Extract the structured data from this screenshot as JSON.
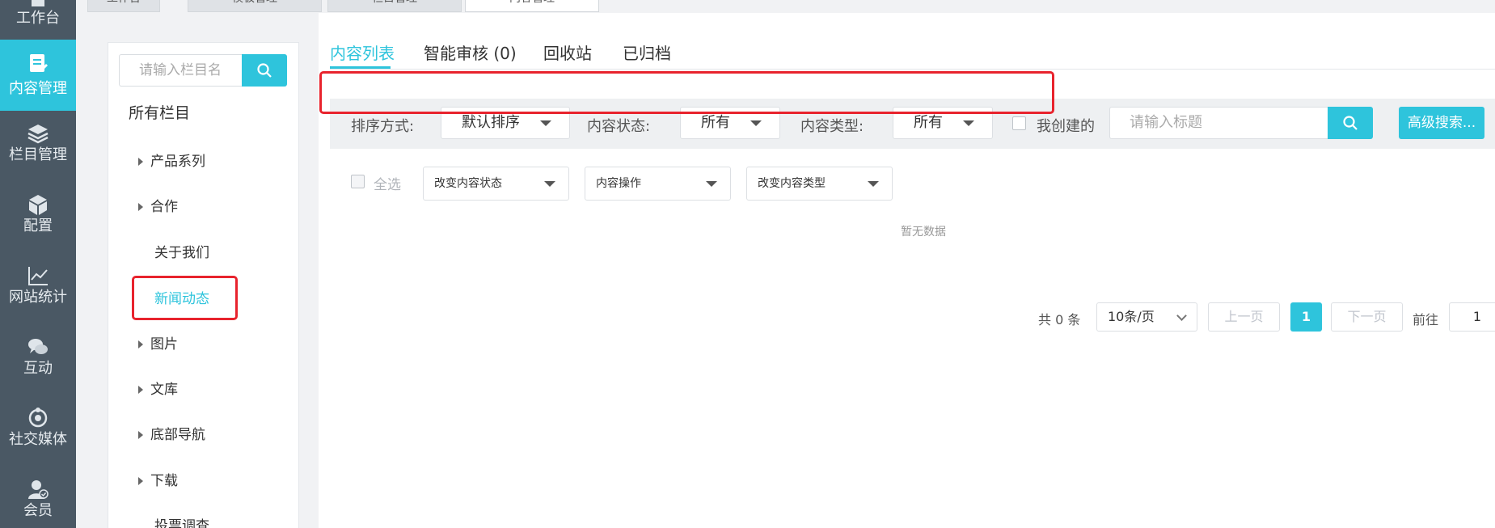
{
  "sidebar": {
    "items": [
      {
        "label": "工作台",
        "icon": "workbench-icon"
      },
      {
        "label": "内容管理",
        "icon": "content-icon",
        "active": true
      },
      {
        "label": "栏目管理",
        "icon": "layers-icon"
      },
      {
        "label": "配置",
        "icon": "box-icon"
      },
      {
        "label": "网站统计",
        "icon": "chart-line-icon"
      },
      {
        "label": "互动",
        "icon": "chat-icon"
      },
      {
        "label": "社交媒体",
        "icon": "social-icon"
      },
      {
        "label": "会员",
        "icon": "member-icon"
      }
    ]
  },
  "top_tabs": [
    "工作台",
    "模板管理",
    "栏目管理",
    "内容管理"
  ],
  "tree": {
    "search_placeholder": "请输入栏目名",
    "root": "所有栏目",
    "nodes": [
      {
        "label": "产品系列",
        "has_children": true
      },
      {
        "label": "合作",
        "has_children": true
      },
      {
        "label": "关于我们",
        "has_children": false
      },
      {
        "label": "新闻动态",
        "has_children": false,
        "selected": true
      },
      {
        "label": "图片",
        "has_children": true
      },
      {
        "label": "文库",
        "has_children": true
      },
      {
        "label": "底部导航",
        "has_children": true
      },
      {
        "label": "下载",
        "has_children": true
      },
      {
        "label": "投票调查",
        "has_children": false
      }
    ]
  },
  "main": {
    "tabs": [
      "内容列表",
      "智能审核 (0)",
      "回收站",
      "已归档"
    ],
    "filters": {
      "sort_label": "排序方式:",
      "sort_value": "默认排序",
      "status_label": "内容状态:",
      "status_value": "所有",
      "type_label": "内容类型:",
      "type_value": "所有",
      "mine_label": "我创建的",
      "title_placeholder": "请输入标题",
      "advanced_label": "高级搜索..."
    },
    "bulk": {
      "select_all": "全选",
      "change_status": "改变内容状态",
      "content_ops": "内容操作",
      "change_type": "改变内容类型"
    },
    "empty_text": "暂无数据",
    "pagination": {
      "total": "共 0 条",
      "page_size": "10条/页",
      "prev": "上一页",
      "current": "1",
      "next": "下一页",
      "goto_label": "前往",
      "goto_value": "1"
    }
  },
  "colors": {
    "accent": "#2ec4dc",
    "sidebar_bg": "#4a5864",
    "highlight_red": "#e8232d"
  }
}
